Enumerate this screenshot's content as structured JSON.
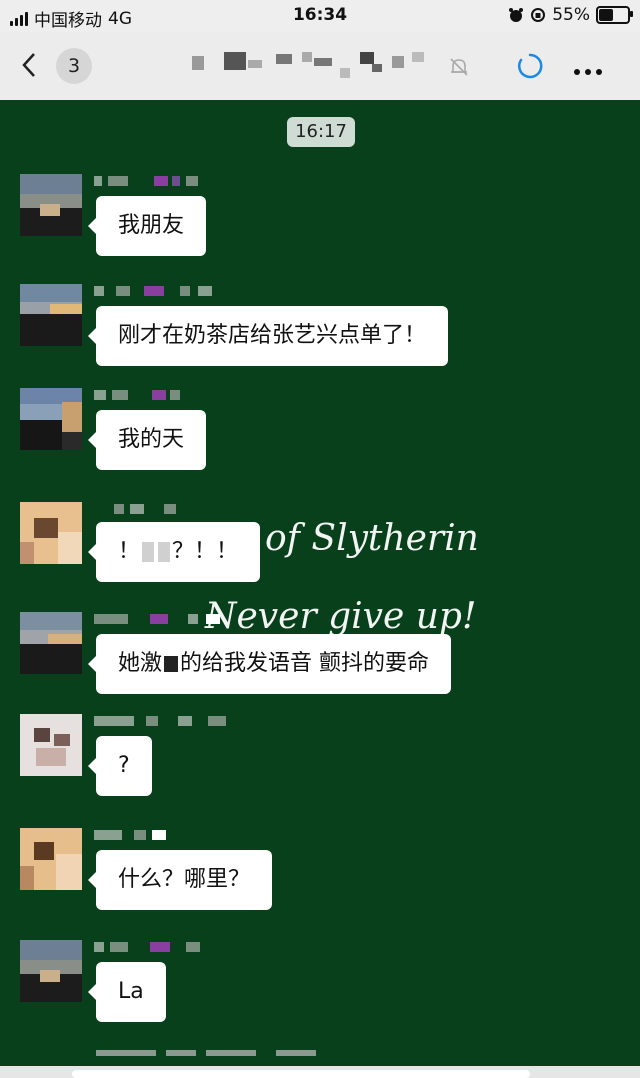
{
  "status_bar": {
    "carrier": "中国移动",
    "network": "4G",
    "time": "16:34",
    "battery_text": "55%",
    "battery_level": 0.55
  },
  "nav": {
    "unread_count": "3",
    "icons": [
      "chevron-left-icon",
      "mute-bell-icon",
      "status-ring-icon",
      "more-icon"
    ]
  },
  "chat": {
    "background_color": "#08401c",
    "timestamp": "16:17",
    "chalkboard_lines": [
      "ident of Slytherin",
      "Never give up!"
    ],
    "messages": [
      {
        "text": "我朋友"
      },
      {
        "text": "刚才在奶茶店给张艺兴点单了！"
      },
      {
        "text": "我的天"
      },
      {
        "text_before": "！",
        "text_after": "？！！"
      },
      {
        "text_before": "她激",
        "text_after": "的给我发语音 颤抖的要命"
      },
      {
        "text": "?"
      },
      {
        "text": "什么？哪里？"
      },
      {
        "text": "La"
      }
    ]
  }
}
